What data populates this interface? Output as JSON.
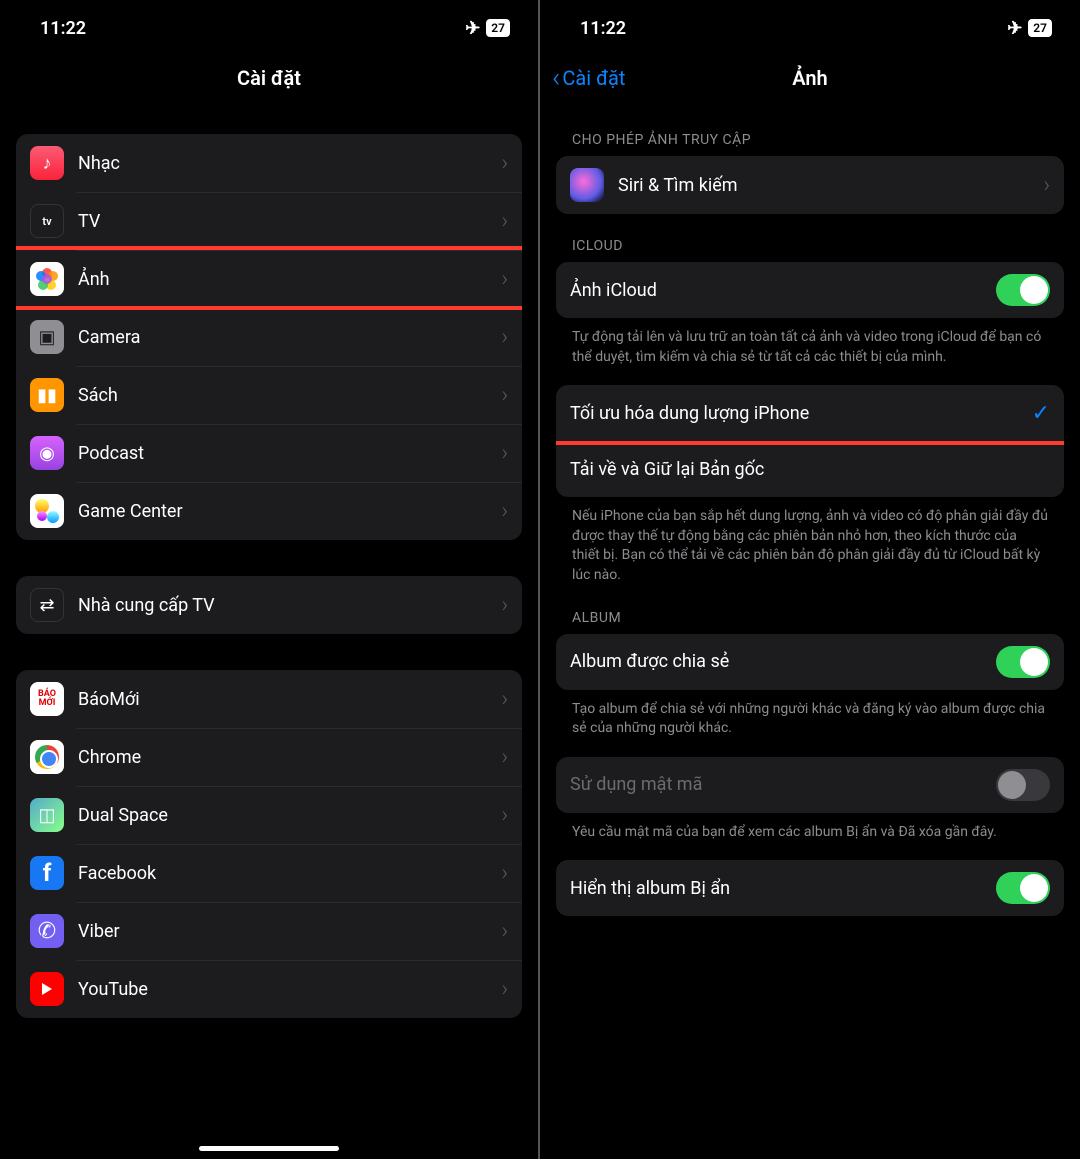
{
  "status": {
    "time": "11:22",
    "battery_pct": "27"
  },
  "left": {
    "title": "Cài đặt",
    "group1": [
      {
        "name": "music",
        "label": "Nhạc"
      },
      {
        "name": "tv",
        "label": "TV"
      },
      {
        "name": "photos",
        "label": "Ảnh",
        "highlight": true
      },
      {
        "name": "camera",
        "label": "Camera"
      },
      {
        "name": "books",
        "label": "Sách"
      },
      {
        "name": "podcast",
        "label": "Podcast"
      },
      {
        "name": "gamecenter",
        "label": "Game Center"
      }
    ],
    "group2": [
      {
        "name": "tvprovider",
        "label": "Nhà cung cấp TV"
      }
    ],
    "group3": [
      {
        "name": "baomoi",
        "label": "BáoMới"
      },
      {
        "name": "chrome",
        "label": "Chrome"
      },
      {
        "name": "dualspace",
        "label": "Dual Space"
      },
      {
        "name": "facebook",
        "label": "Facebook"
      },
      {
        "name": "viber",
        "label": "Viber"
      },
      {
        "name": "youtube",
        "label": "YouTube"
      }
    ]
  },
  "right": {
    "back_label": "Cài đặt",
    "title": "Ảnh",
    "allow_access_header": "CHO PHÉP ẢNH TRUY CẬP",
    "siri_row": "Siri & Tìm kiếm",
    "icloud_header": "ICLOUD",
    "icloud_photos_label": "Ảnh iCloud",
    "icloud_photos_desc": "Tự động tải lên và lưu trữ an toàn tất cả ảnh và video trong iCloud để bạn có thể duyệt, tìm kiếm và chia sẻ từ tất cả các thiết bị của mình.",
    "optimize_label": "Tối ưu hóa dung lượng iPhone",
    "download_label": "Tải về và Giữ lại Bản gốc",
    "optimize_desc": "Nếu iPhone của bạn sắp hết dung lượng, ảnh và video có độ phân giải đầy đủ được thay thế tự động bằng các phiên bản nhỏ hơn, theo kích thước của thiết bị. Bạn có thể tải về các phiên bản độ phân giải đầy đủ từ iCloud bất kỳ lúc nào.",
    "album_header": "ALBUM",
    "shared_album_label": "Album được chia sẻ",
    "shared_album_desc": "Tạo album để chia sẻ với những người khác và đăng ký vào album được chia sẻ của những người khác.",
    "passcode_label": "Sử dụng mật mã",
    "passcode_desc": "Yêu cầu mật mã của bạn để xem các album Bị ẩn và Đã xóa gần đây.",
    "hidden_album_label": "Hiển thị album Bị ẩn"
  }
}
